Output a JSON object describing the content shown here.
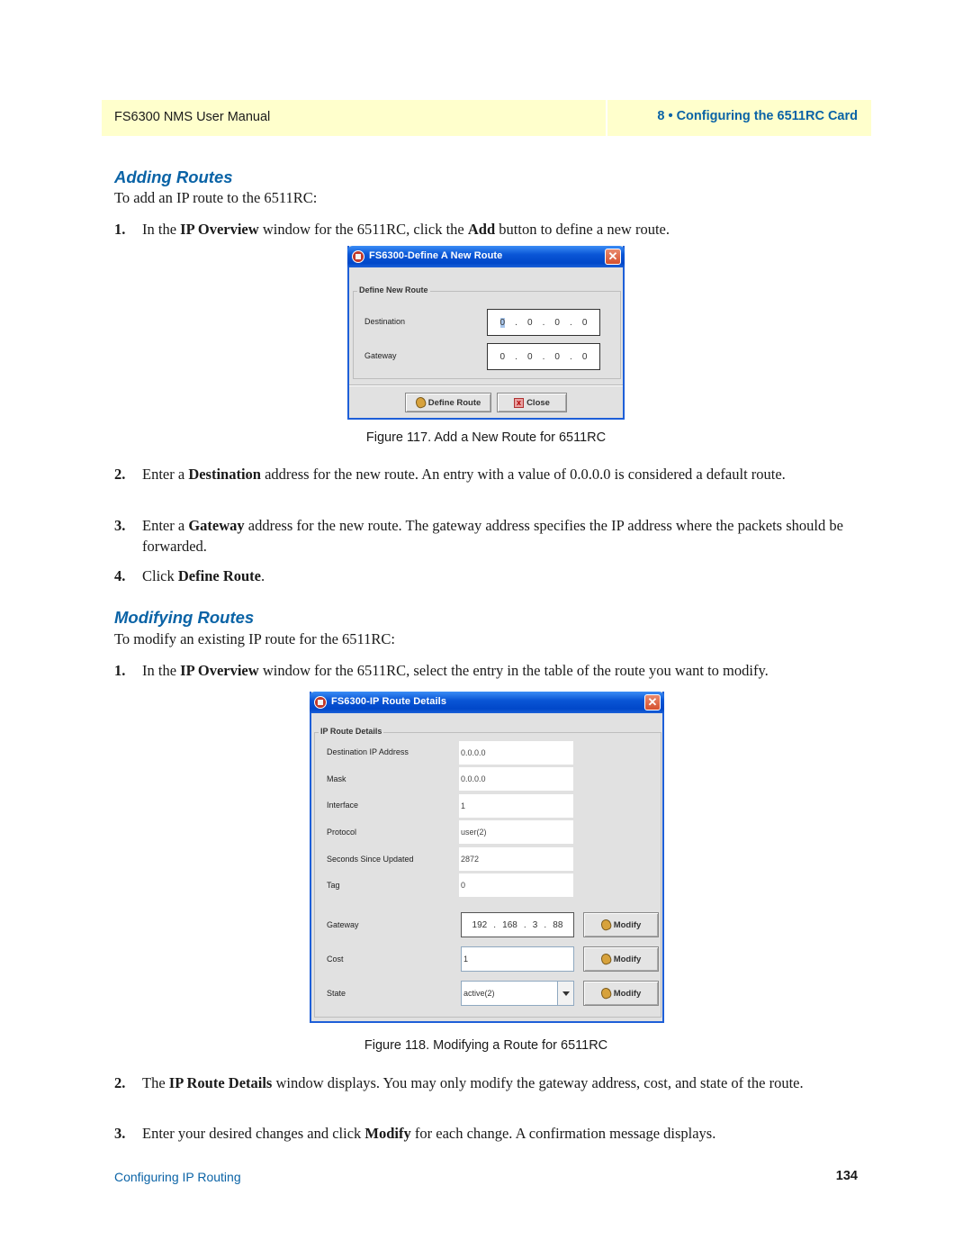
{
  "header": {
    "manual_title": "FS6300 NMS User Manual",
    "chapter": "8 • Configuring the 6511RC Card"
  },
  "adding": {
    "heading": "Adding Routes",
    "intro": "To add an IP route to the 6511RC:",
    "step1": {
      "num": "1.",
      "pre": "In the ",
      "b1": "IP Overview",
      "mid": " window for the 6511RC, click the ",
      "b2": "Add",
      "post": " button to define a new route."
    },
    "step2": {
      "num": "2.",
      "pre": "Enter a ",
      "b1": "Destination",
      "post": " address for the new route. An entry with a value of 0.0.0.0 is considered a default route."
    },
    "step3": {
      "num": "3.",
      "pre": "Enter a ",
      "b1": "Gateway",
      "post": " address for the new route. The gateway address specifies the IP address where the packets should be forwarded."
    },
    "step4": {
      "num": "4.",
      "pre": "Click ",
      "b1": "Define Route",
      "post": "."
    },
    "caption": "Figure 117. Add a New Route for 6511RC"
  },
  "define_dialog": {
    "title": "FS6300-Define A New Route",
    "close_glyph": "✕",
    "group_label": "Define New Route",
    "destination_label": "Destination",
    "destination_octets": [
      "0",
      "0",
      "0",
      "0"
    ],
    "gateway_label": "Gateway",
    "gateway_octets": [
      "0",
      "0",
      "0",
      "0"
    ],
    "dot": ".",
    "define_button": "Define Route",
    "close_button": "Close",
    "close_x": "x"
  },
  "modifying": {
    "heading": "Modifying Routes",
    "intro": "To modify an existing IP route for the 6511RC:",
    "step1": {
      "num": "1.",
      "pre": "In the ",
      "b1": "IP Overview",
      "post": " window for the 6511RC, select the entry in the table of the route you want to modify."
    },
    "step2": {
      "num": "2.",
      "pre": "The ",
      "b1": "IP Route Details",
      "post": " window displays. You may only modify the gateway address, cost, and state of the route."
    },
    "step3": {
      "num": "3.",
      "pre": "Enter your desired changes and click ",
      "b1": "Modify",
      "post": " for each change. A confirmation message displays."
    },
    "caption": "Figure 118. Modifying a Route for 6511RC"
  },
  "details_dialog": {
    "title": "FS6300-IP Route Details",
    "close_glyph": "✕",
    "group_label": "IP Route Details",
    "fields": [
      {
        "label": "Destination IP Address",
        "value": "0.0.0.0"
      },
      {
        "label": "Mask",
        "value": "0.0.0.0"
      },
      {
        "label": "Interface",
        "value": "1"
      },
      {
        "label": "Protocol",
        "value": "user(2)"
      },
      {
        "label": "Seconds Since Updated",
        "value": "2872"
      },
      {
        "label": "Tag",
        "value": "0"
      }
    ],
    "gateway_label": "Gateway",
    "gateway_octets": [
      "192",
      "168",
      "3",
      "88"
    ],
    "dot": ".",
    "cost_label": "Cost",
    "cost_value": "1",
    "state_label": "State",
    "state_value": "active(2)",
    "modify_button": "Modify"
  },
  "footer": {
    "section": "Configuring IP Routing",
    "page_number": "134"
  }
}
